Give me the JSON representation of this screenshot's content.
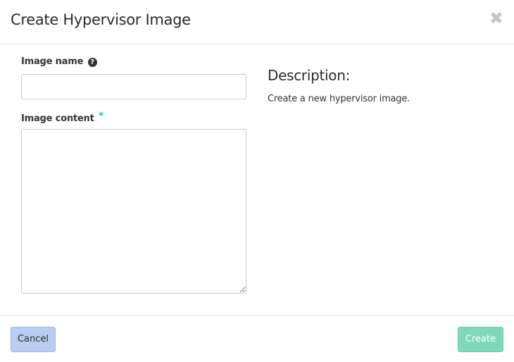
{
  "dialog": {
    "title": "Create Hypervisor Image",
    "close_symbol": "✖"
  },
  "form": {
    "image_name": {
      "label": "Image name",
      "help_icon": "question-circle-icon",
      "help_glyph": "?",
      "value": "",
      "placeholder": ""
    },
    "image_content": {
      "label": "Image content",
      "required_mark": "*",
      "value": "",
      "placeholder": ""
    }
  },
  "description": {
    "heading": "Description:",
    "text": "Create a new hypervisor image."
  },
  "footer": {
    "cancel_label": "Cancel",
    "create_label": "Create"
  },
  "colors": {
    "required_star": "#3cc48f",
    "cancel_bg": "#b9cdf2",
    "create_bg": "#7fd8bb"
  }
}
